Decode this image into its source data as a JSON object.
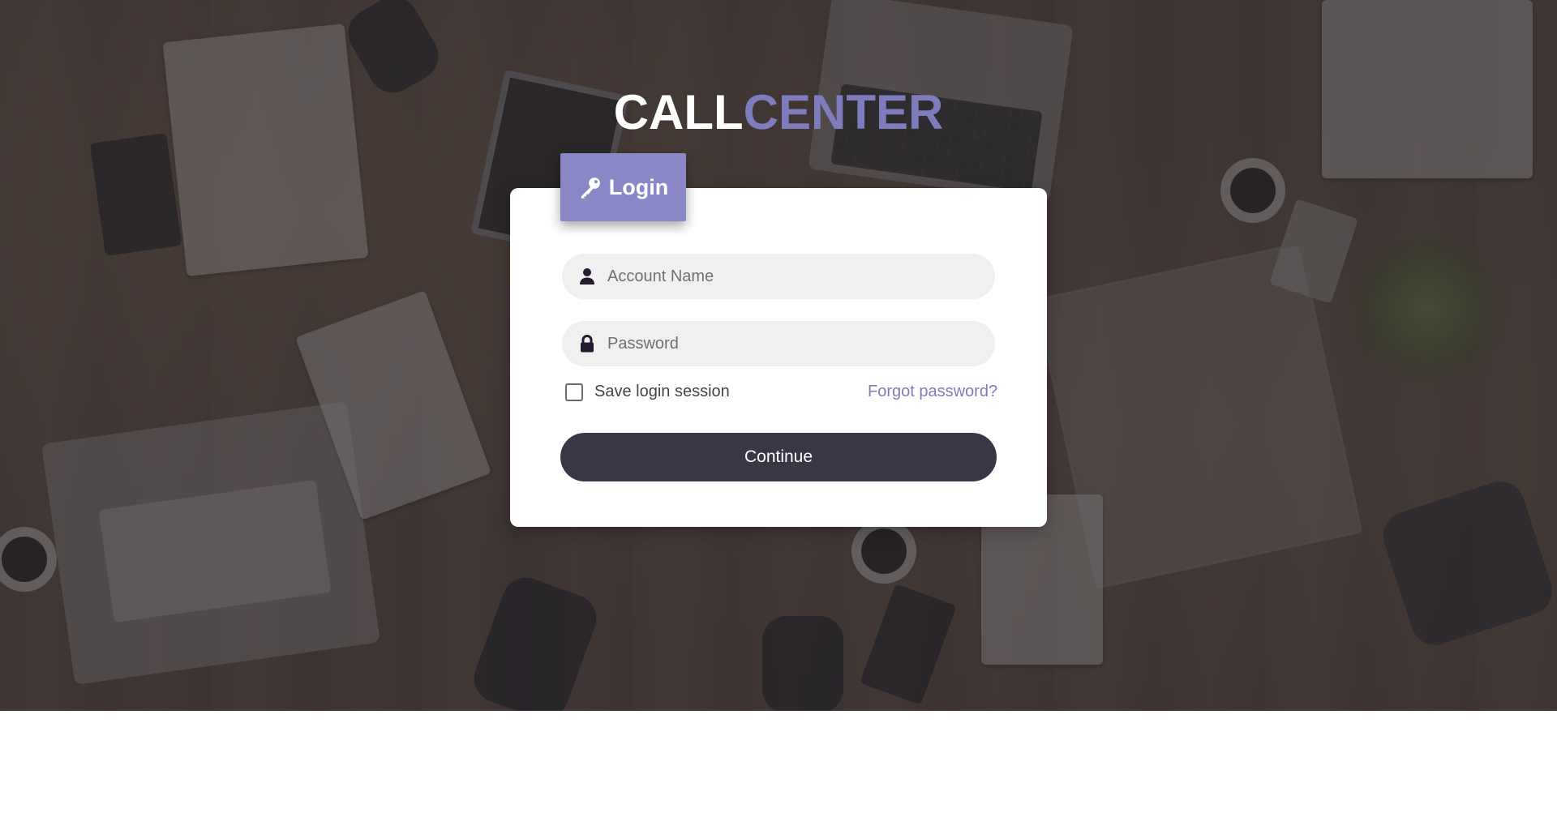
{
  "brand": {
    "part1": "CALL",
    "part2": "CENTER"
  },
  "login_tab": {
    "icon": "key-icon",
    "label": "Login"
  },
  "form": {
    "account": {
      "icon": "user-icon",
      "placeholder": "Account Name",
      "value": ""
    },
    "password": {
      "icon": "lock-icon",
      "placeholder": "Password",
      "value": ""
    },
    "remember_label": "Save login session",
    "remember_checked": false,
    "forgot_label": "Forgot password?",
    "submit_label": "Continue"
  },
  "colors": {
    "accent": "#8987c5",
    "brand_accent": "#7f7cbd",
    "button": "#393645",
    "icon": "#241b2f"
  }
}
